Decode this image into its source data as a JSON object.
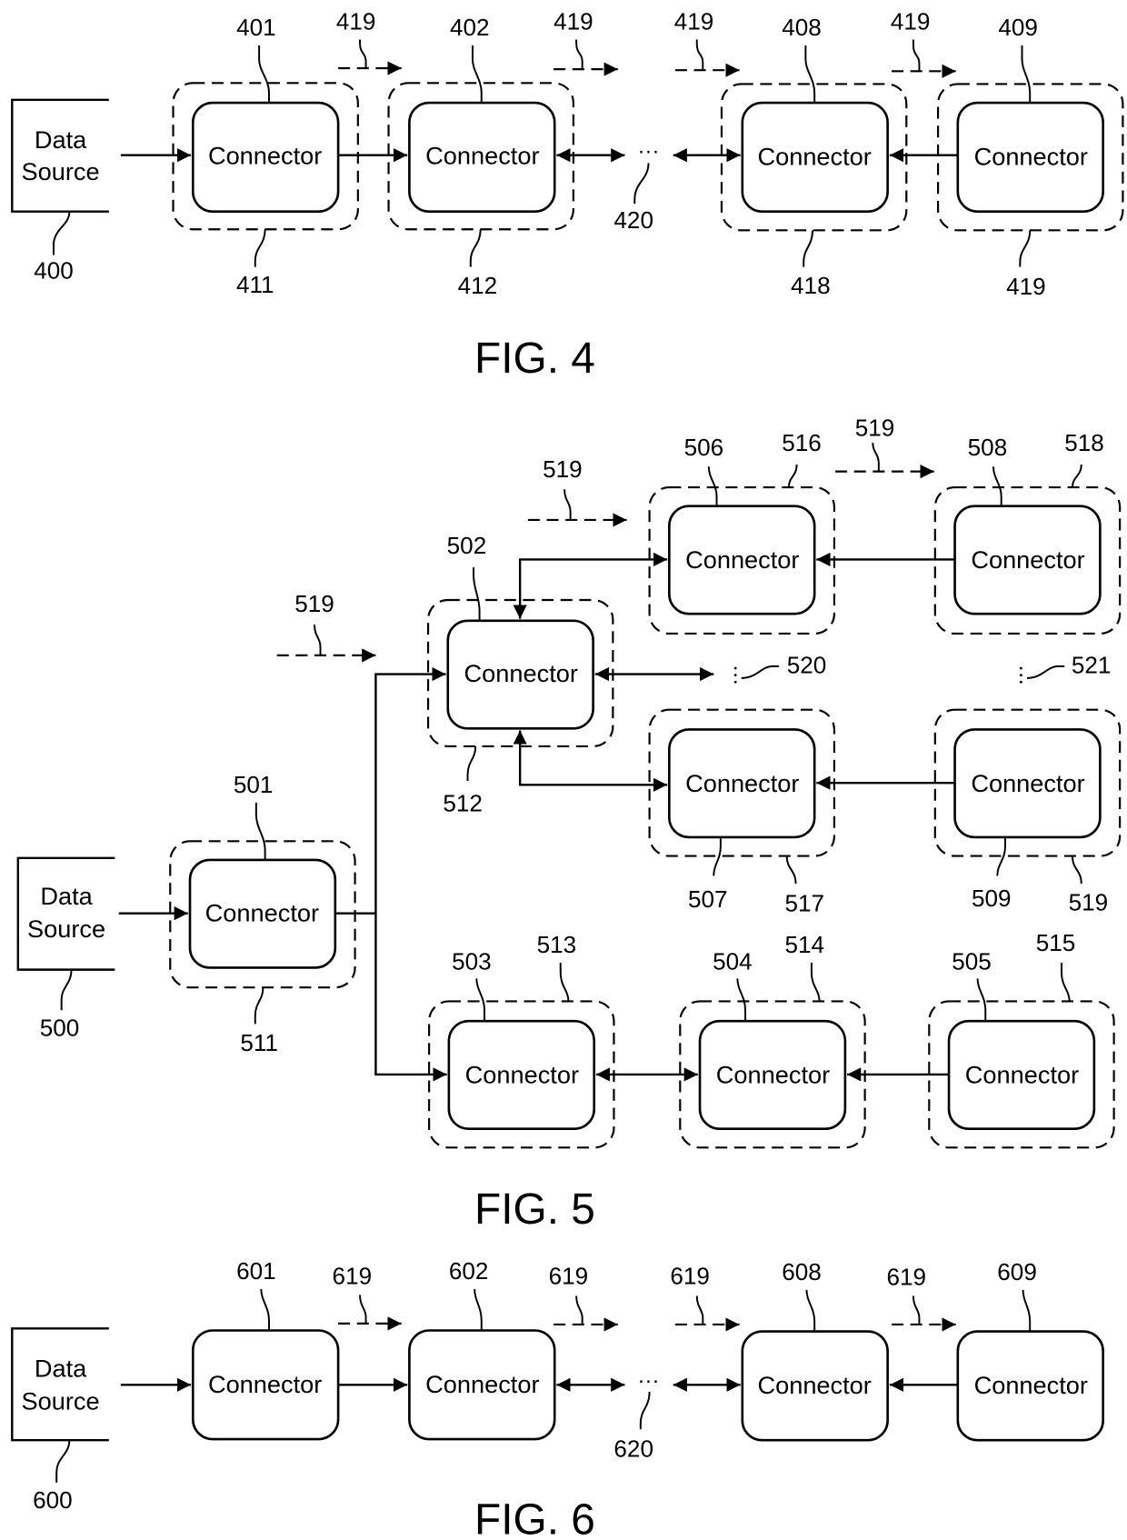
{
  "colors": {
    "ink": "#000000",
    "paper": "#ffffff"
  },
  "node_label": "Connector",
  "data_source_lines": [
    "Data",
    "Source"
  ],
  "figures": [
    {
      "id": "fig4",
      "title": "FIG. 4",
      "data_source_ref": "400",
      "connector_refs": [
        "401",
        "402",
        "408",
        "409"
      ],
      "container_refs": [
        "411",
        "412",
        "418",
        "419"
      ],
      "flow_indicator_ref": "419",
      "ellipsis": "···",
      "ellipsis_ref": "420"
    },
    {
      "id": "fig5",
      "title": "FIG. 5",
      "data_source_ref": "500",
      "connector_refs": [
        "501",
        "502",
        "503",
        "504",
        "505",
        "506",
        "507",
        "508",
        "509"
      ],
      "container_refs": [
        "511",
        "512",
        "513",
        "514",
        "515",
        "516",
        "517",
        "518",
        "519"
      ],
      "flow_indicator_ref": "519",
      "ellipsis_refs": [
        "520",
        "521"
      ]
    },
    {
      "id": "fig6",
      "title": "FIG. 6",
      "data_source_ref": "600",
      "connector_refs": [
        "601",
        "602",
        "608",
        "609"
      ],
      "flow_indicator_ref": "619",
      "ellipsis": "···",
      "ellipsis_ref": "620"
    }
  ]
}
